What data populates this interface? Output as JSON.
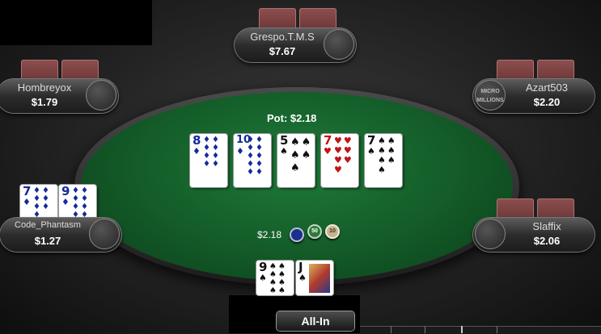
{
  "pot": {
    "label": "Pot: $2.18"
  },
  "board": [
    {
      "rank": "8",
      "suit": "♦",
      "pips": "♦♦♦♦♦♦♦♦",
      "color": "blue"
    },
    {
      "rank": "10",
      "suit": "♦",
      "pips": "♦♦♦♦♦♦♦♦♦♦",
      "color": "blue"
    },
    {
      "rank": "5",
      "suit": "♠",
      "pips": "♠♠♠♠♠",
      "color": "black"
    },
    {
      "rank": "7",
      "suit": "♥",
      "pips": "♥♥♥♥♥♥♥",
      "color": "red"
    },
    {
      "rank": "7",
      "suit": "♠",
      "pips": "♠♠♠♠♠♠♠",
      "color": "black"
    }
  ],
  "players": {
    "top": {
      "name": "Grespo.T.M.S",
      "stack": "$7.67"
    },
    "top_left": {
      "name": "Hombreyox",
      "stack": "$1.79"
    },
    "top_right": {
      "name": "Azart503",
      "stack": "$2.20",
      "avatar_text": "MICRO MILLIONS"
    },
    "left": {
      "name": "Code_Phantasm",
      "stack": "$1.27"
    },
    "right": {
      "name": "Slaffix",
      "stack": "$2.06"
    }
  },
  "left_hand": [
    {
      "rank": "7",
      "suit": "♦",
      "pips": "♦♦♦♦♦♦♦",
      "color": "blue"
    },
    {
      "rank": "9",
      "suit": "♦",
      "pips": "♦♦♦♦♦♦♦♦♦",
      "color": "blue"
    }
  ],
  "hero_hand": [
    {
      "rank": "9",
      "suit": "♠",
      "pips": "♠♠♠♠♠♠♠♠♠",
      "color": "black"
    },
    {
      "rank": "J",
      "suit": "♠",
      "pips": "♠",
      "color": "black"
    }
  ],
  "bet": {
    "amount": "$2.18",
    "chips": [
      "",
      "50",
      "10"
    ]
  },
  "actions": {
    "all_in": "All-In"
  },
  "colors": {
    "felt": "#135a27",
    "card_back": "#8c4f4f"
  }
}
